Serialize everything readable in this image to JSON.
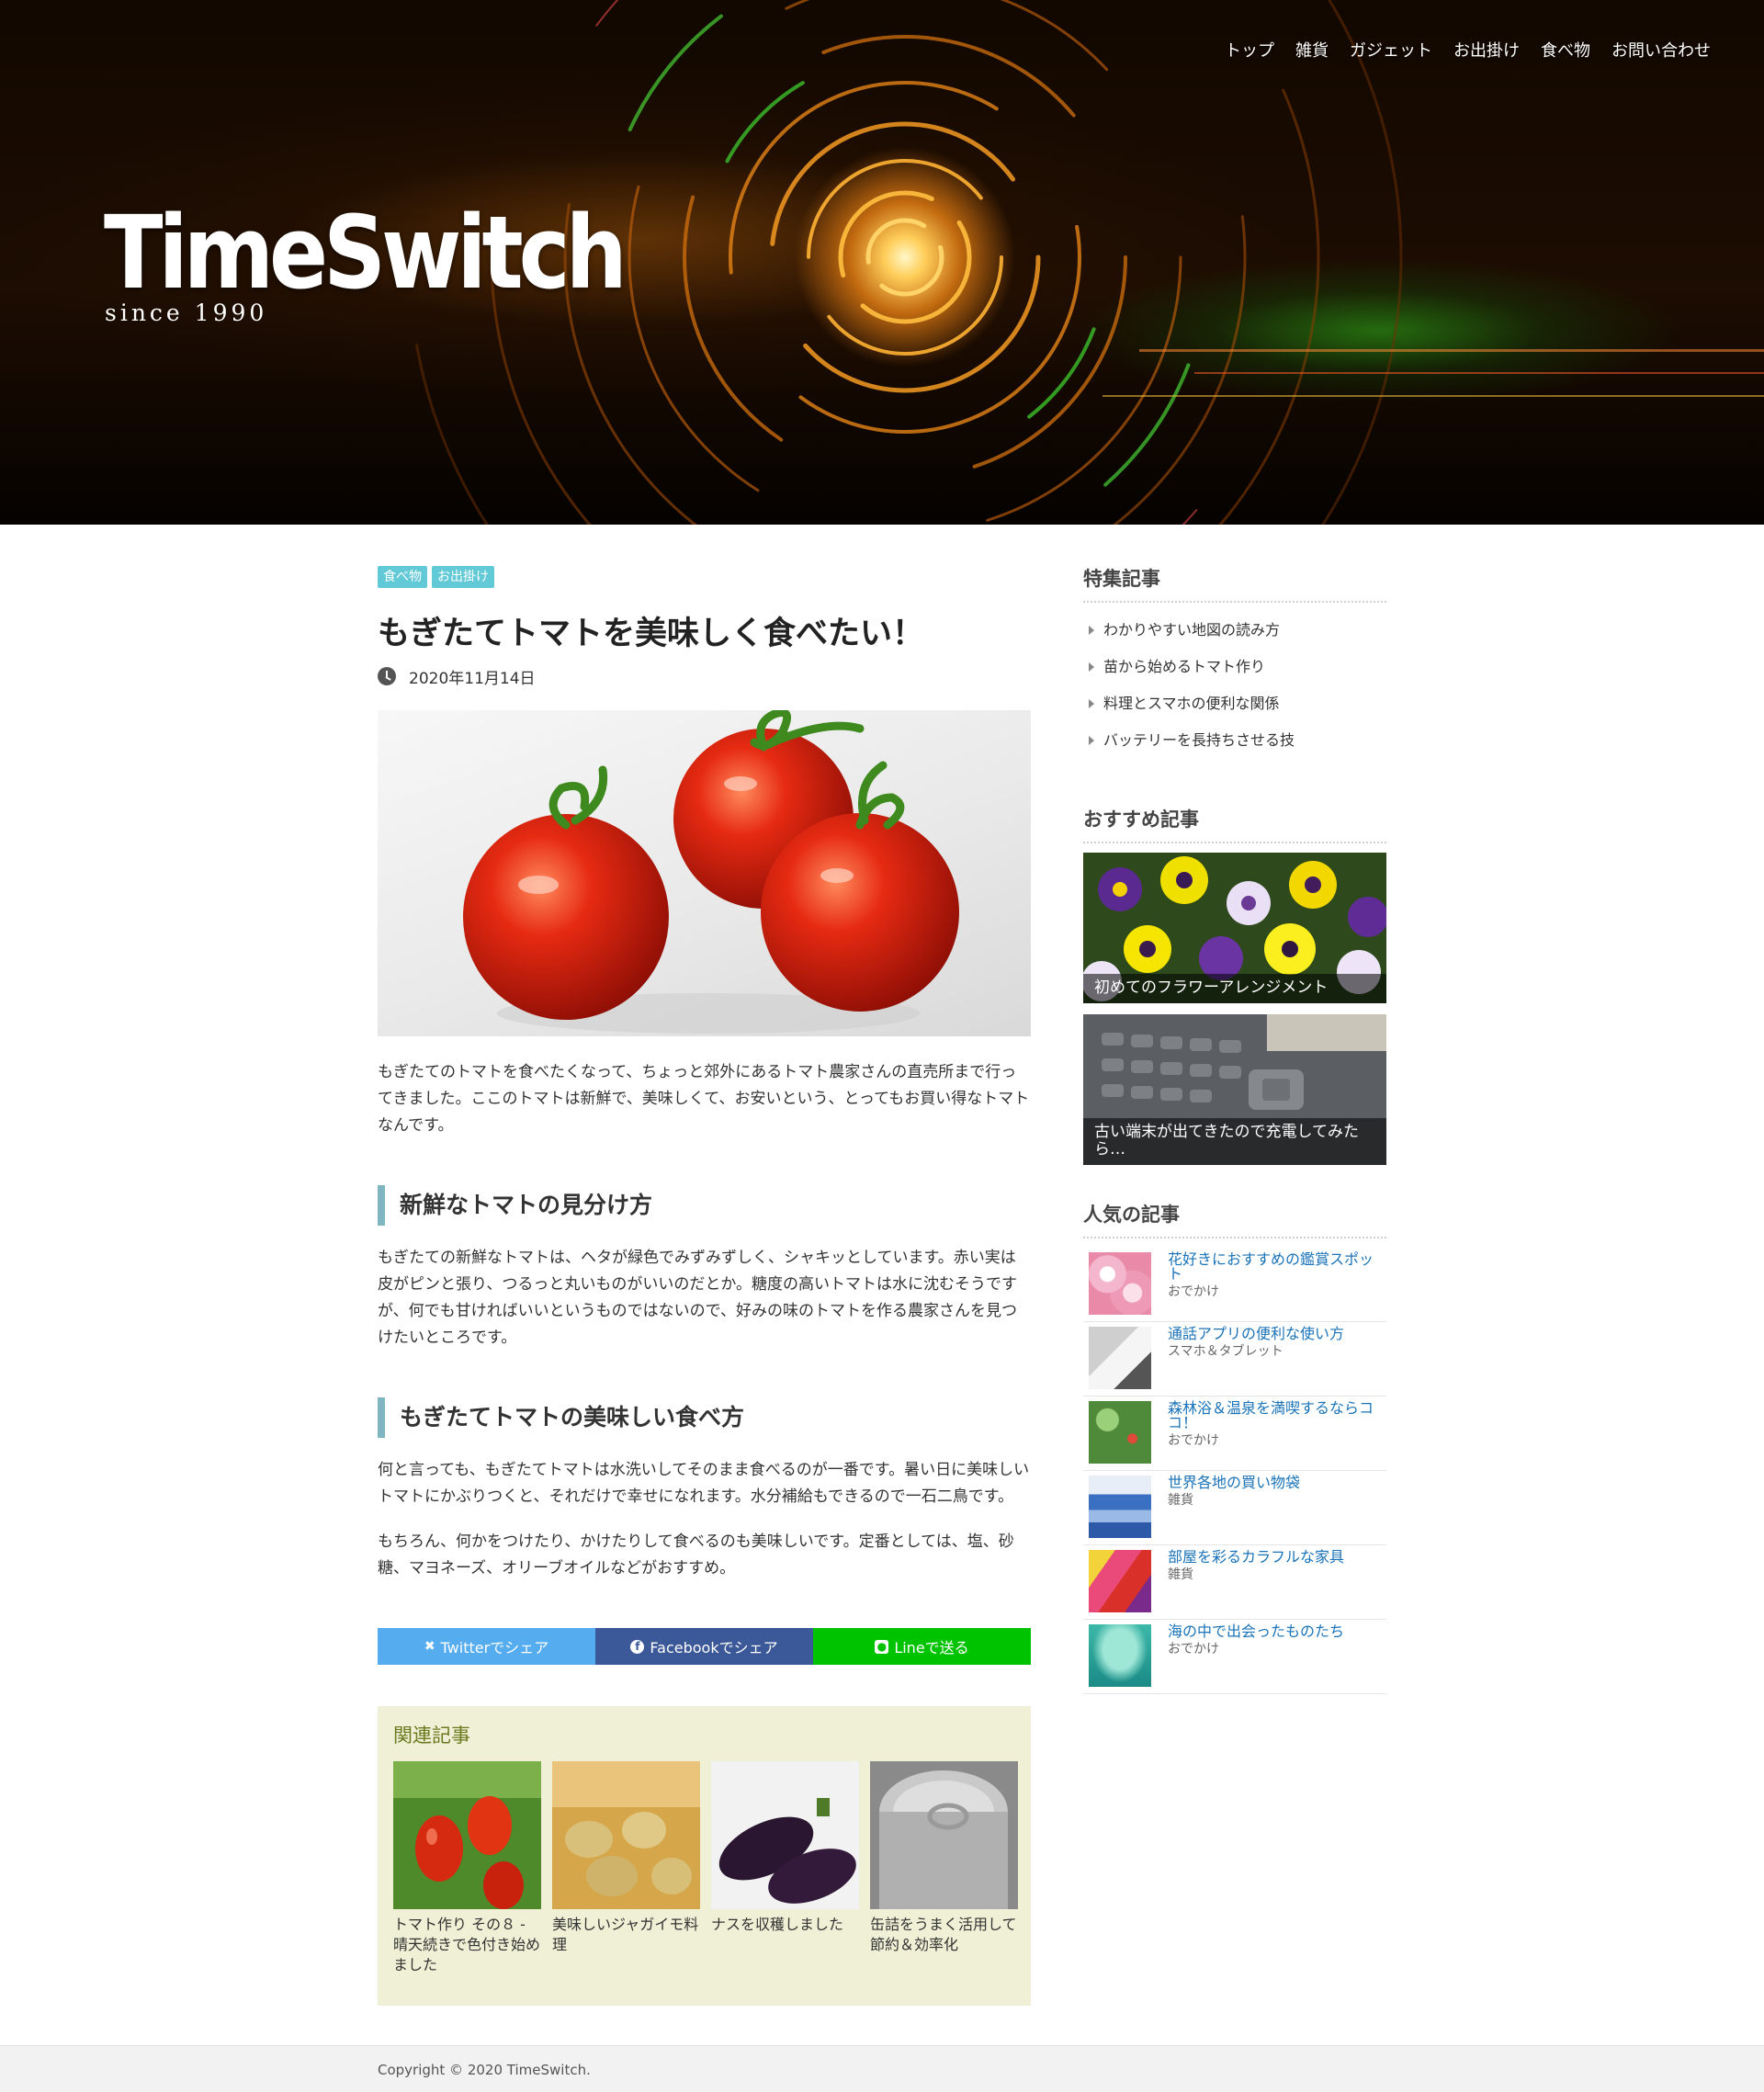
{
  "header": {
    "logo": "TimeSwitch",
    "tagline": "since 1990",
    "nav": [
      "トップ",
      "雑貨",
      "ガジェット",
      "お出掛け",
      "食べ物",
      "お問い合わせ"
    ]
  },
  "article": {
    "categories": [
      "食べ物",
      "お出掛け"
    ],
    "title": "もぎたてトマトを美味しく食べたい！",
    "date": "2020年11月14日",
    "lead": "もぎたてのトマトを食べたくなって、ちょっと郊外にあるトマト農家さんの直売所まで行ってきました。ここのトマトは新鮮で、美味しくて、お安いという、とってもお買い得なトマトなんです。",
    "sections": [
      {
        "heading": "新鮮なトマトの見分け方",
        "paragraphs": [
          "もぎたての新鮮なトマトは、ヘタが緑色でみずみずしく、シャキッとしています。赤い実は皮がピンと張り、つるっと丸いものがいいのだとか。糖度の高いトマトは水に沈むそうですが、何でも甘ければいいというものではないので、好みの味のトマトを作る農家さんを見つけたいところです。"
        ]
      },
      {
        "heading": "もぎたてトマトの美味しい食べ方",
        "paragraphs": [
          "何と言っても、もぎたてトマトは水洗いしてそのまま食べるのが一番です。暑い日に美味しいトマトにかぶりつくと、それだけで幸せになれます。水分補給もできるので一石二鳥です。",
          "もちろん、何かをつけたり、かけたりして食べるのも美味しいです。定番としては、塩、砂糖、マヨネーズ、オリーブオイルなどがおすすめ。"
        ]
      }
    ],
    "share": {
      "twitter": "Twitterでシェア",
      "facebook": "Facebookでシェア",
      "line": "Lineで送る"
    },
    "related": {
      "heading": "関連記事",
      "items": [
        "トマト作り その８ - 晴天続きで色付き始めました",
        "美味しいジャガイモ料理",
        "ナスを収穫しました",
        "缶詰をうまく活用して節約＆効率化"
      ]
    }
  },
  "sidebar": {
    "featured": {
      "heading": "特集記事",
      "items": [
        "わかりやすい地図の読み方",
        "苗から始めるトマト作り",
        "料理とスマホの便利な関係",
        "バッテリーを長持ちさせる技"
      ]
    },
    "recommended": {
      "heading": "おすすめ記事",
      "items": [
        "初めてのフラワーアレンジメント",
        "古い端末が出てきたので充電してみたら…"
      ]
    },
    "popular": {
      "heading": "人気の記事",
      "items": [
        {
          "title": "花好きにおすすめの鑑賞スポット",
          "category": "おでかけ"
        },
        {
          "title": "通話アプリの便利な使い方",
          "category": "スマホ＆タブレット"
        },
        {
          "title": "森林浴＆温泉を満喫するならココ！",
          "category": "おでかけ"
        },
        {
          "title": "世界各地の買い物袋",
          "category": "雑貨"
        },
        {
          "title": "部屋を彩るカラフルな家具",
          "category": "雑貨"
        },
        {
          "title": "海の中で出会ったものたち",
          "category": "おでかけ"
        }
      ]
    }
  },
  "footer": {
    "copyright": "Copyright © 2020 TimeSwitch."
  },
  "colors": {
    "category_badge": "#62c9d6",
    "heading_bar": "#7fb6c1",
    "twitter": "#55acee",
    "facebook": "#3b5998",
    "line": "#00c300",
    "related_bg": "#eff0d5",
    "popular_link": "#1a73b8"
  },
  "icons": [
    "clock-icon",
    "twitter-icon",
    "facebook-icon",
    "line-icon",
    "arrow-right-icon"
  ]
}
